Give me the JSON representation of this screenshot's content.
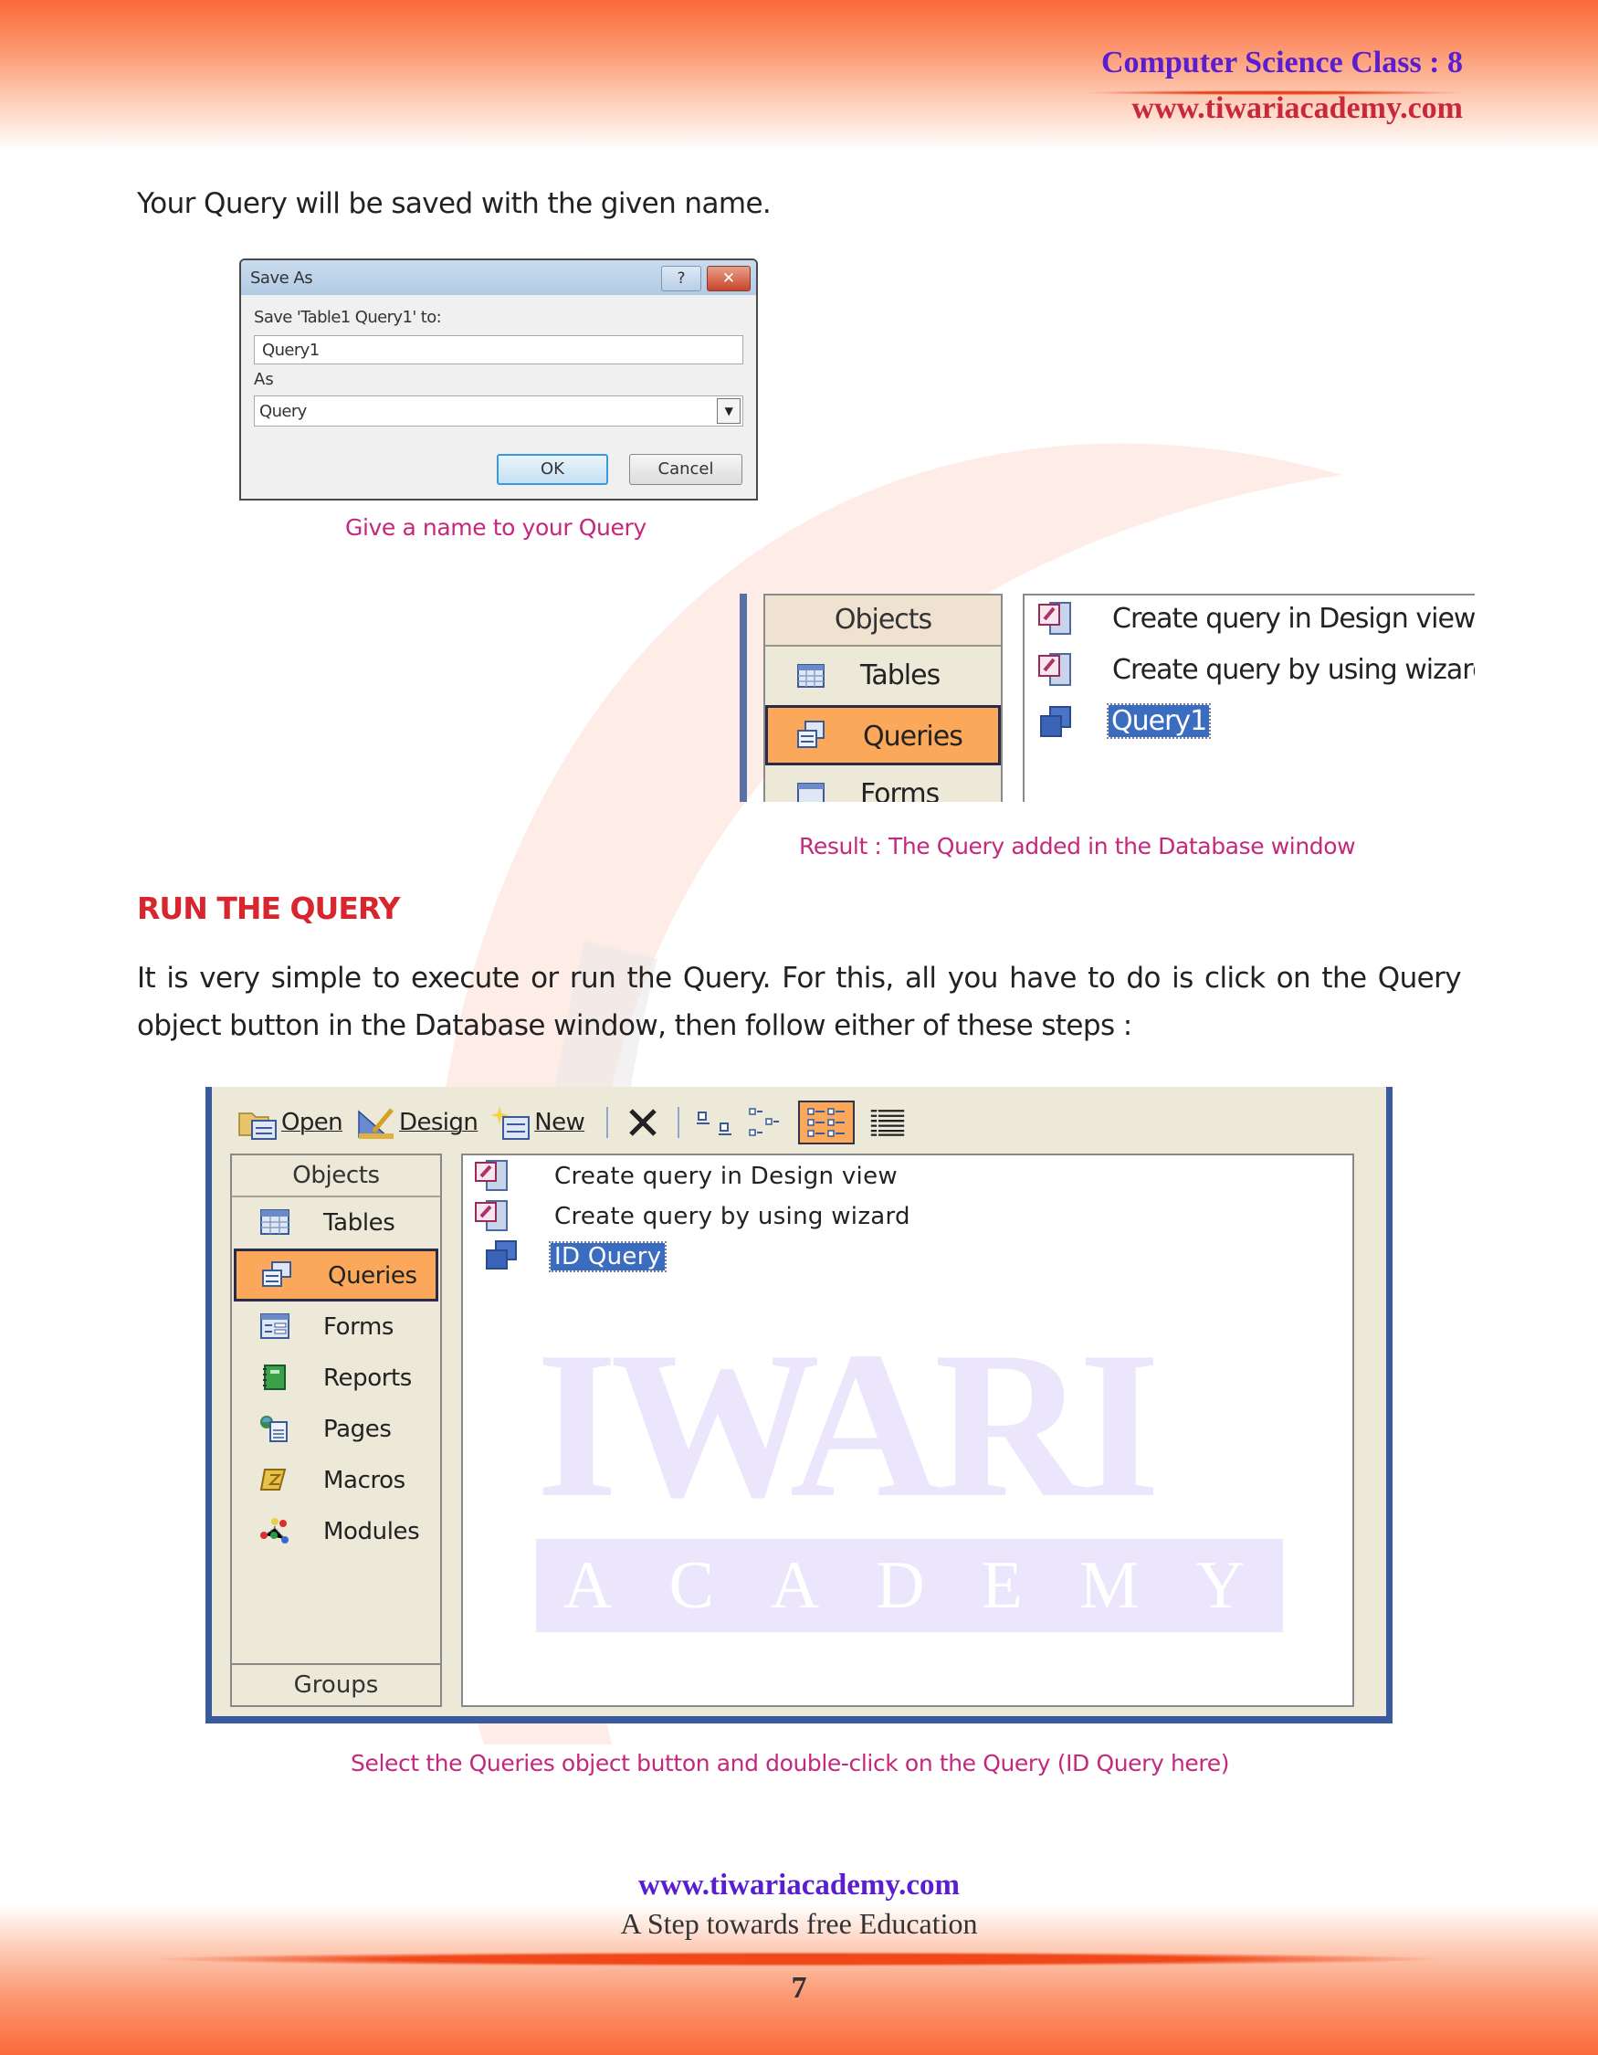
{
  "header": {
    "title": "Computer Science Class : 8",
    "url": "www.tiwariacademy.com"
  },
  "intro_text": "Your Query will be saved with the given name.",
  "save_as_dialog": {
    "title": "Save As",
    "help_label": "?",
    "close_label": "✕",
    "save_label": "Save 'Table1 Query1' to:",
    "name_value": "Query1",
    "as_label": "As",
    "as_value": "Query",
    "ok_label": "OK",
    "cancel_label": "Cancel"
  },
  "caption_1": "Give a name to your Query",
  "result_window": {
    "objects_header": "Objects",
    "objects": [
      {
        "label": "Tables",
        "icon": "table-icon"
      },
      {
        "label": "Queries",
        "icon": "queries-icon",
        "selected": true
      },
      {
        "label": "Forms",
        "icon": "forms-icon"
      }
    ],
    "items": [
      {
        "label": "Create query in Design view",
        "icon": "design-view-icon"
      },
      {
        "label": "Create query by using wizard",
        "icon": "wizard-icon"
      },
      {
        "label": "Query1",
        "icon": "query-icon",
        "selected": true
      }
    ]
  },
  "caption_2": "Result : The Query added in the Database window",
  "section": {
    "heading": "RUN THE QUERY",
    "paragraph": "It is very simple to execute or run the Query. For this, all you have to do is click on the Query object button in the Database window, then follow either of these steps :"
  },
  "database_window": {
    "toolbar": {
      "open_label": "Open",
      "design_label": "Design",
      "new_label": "New",
      "icons": [
        "delete-icon",
        "large-icons-view-icon",
        "small-icons-view-icon",
        "list-view-icon",
        "details-view-icon"
      ],
      "active_view": "list-view-icon"
    },
    "objects_header": "Objects",
    "objects": [
      {
        "label": "Tables",
        "icon": "table-icon"
      },
      {
        "label": "Queries",
        "icon": "queries-icon",
        "selected": true
      },
      {
        "label": "Forms",
        "icon": "forms-icon"
      },
      {
        "label": "Reports",
        "icon": "reports-icon"
      },
      {
        "label": "Pages",
        "icon": "pages-icon"
      },
      {
        "label": "Macros",
        "icon": "macros-icon"
      },
      {
        "label": "Modules",
        "icon": "modules-icon"
      }
    ],
    "groups_label": "Groups",
    "items": [
      {
        "label": "Create query in Design view",
        "icon": "design-view-icon"
      },
      {
        "label": "Create query by using wizard",
        "icon": "wizard-icon"
      },
      {
        "label": "ID Query",
        "icon": "query-icon",
        "selected": true
      }
    ],
    "watermark": {
      "top": "IWARI",
      "bottom": "ACADEMY"
    }
  },
  "caption_3": "Select the Queries object button and double-click on the Query (ID Query here)",
  "footer": {
    "url": "www.tiwariacademy.com",
    "tagline": "A Step towards free Education",
    "page_number": "7"
  },
  "colors": {
    "accent_orange": "#fb6a3a",
    "heading_red": "#d7262e",
    "caption_pink": "#c4287c",
    "header_purple": "#5a1dd0",
    "selected_orange": "#fba85a",
    "selection_blue": "#3a6cc0"
  }
}
